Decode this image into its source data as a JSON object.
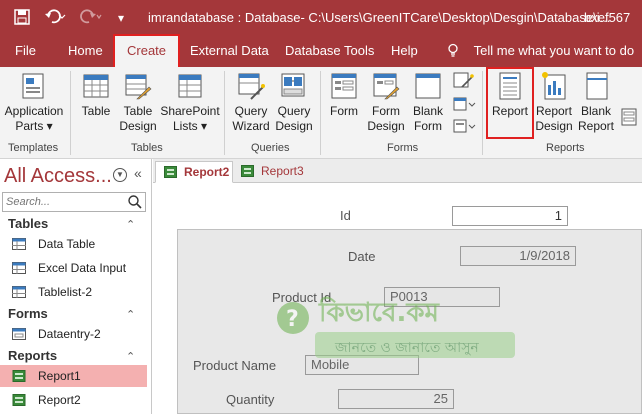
{
  "titlebar": {
    "title": "imrandatabase : Database- C:\\Users\\GreenITCare\\Desktop\\Desgin\\Database\\i...",
    "user": "bxef567",
    "save_icon": "save-icon",
    "undo_icon": "undo-icon",
    "redo_icon": "redo-icon"
  },
  "menu": {
    "tabs": [
      "File",
      "Home",
      "Create",
      "External Data",
      "Database Tools",
      "Help"
    ],
    "active": "Create",
    "tell_me": "Tell me what you want to do"
  },
  "ribbon": {
    "templates": {
      "group": "Templates",
      "application_parts": [
        "Application",
        "Parts ▾"
      ]
    },
    "tables": {
      "group": "Tables",
      "table": "Table",
      "table_design": [
        "Table",
        "Design"
      ],
      "sharepoint_lists": [
        "SharePoint",
        "Lists ▾"
      ]
    },
    "queries": {
      "group": "Queries",
      "query_wizard": [
        "Query",
        "Wizard"
      ],
      "query_design": [
        "Query",
        "Design"
      ]
    },
    "forms": {
      "group": "Forms",
      "form": "Form",
      "form_design": [
        "Form",
        "Design"
      ],
      "blank_form": [
        "Blank",
        "Form"
      ]
    },
    "reports": {
      "group": "Reports",
      "report": "Report",
      "report_design": [
        "Report",
        "Design"
      ],
      "blank_report": [
        "Blank",
        "Report"
      ]
    }
  },
  "nav": {
    "title": "All Access...",
    "search_placeholder": "Search...",
    "sections": {
      "tables": {
        "label": "Tables",
        "items": [
          "Data Table",
          "Excel Data Input",
          "Tablelist-2"
        ]
      },
      "forms": {
        "label": "Forms",
        "items": [
          "Dataentry-2"
        ]
      },
      "reports": {
        "label": "Reports",
        "items": [
          "Report1",
          "Report2"
        ],
        "selected": "Report1"
      }
    }
  },
  "doc_tabs": [
    "Report2",
    "Report3"
  ],
  "report": {
    "id": {
      "label": "Id",
      "value": "1"
    },
    "date": {
      "label": "Date",
      "value": "1/9/2018"
    },
    "product_id": {
      "label": "Product Id",
      "value": "P0013"
    },
    "product_name": {
      "label": "Product Name",
      "value": "Mobile"
    },
    "quantity": {
      "label": "Quantity",
      "value": "25"
    }
  },
  "watermark": {
    "title": "কিভাবে.কম",
    "tagline": "জানতে ও জানাতে আসুন"
  },
  "colors": {
    "accent": "#a4373a",
    "highlight": "#e02020",
    "selected_row": "#f4b0b0",
    "watermark_green": "#6ab04c"
  }
}
